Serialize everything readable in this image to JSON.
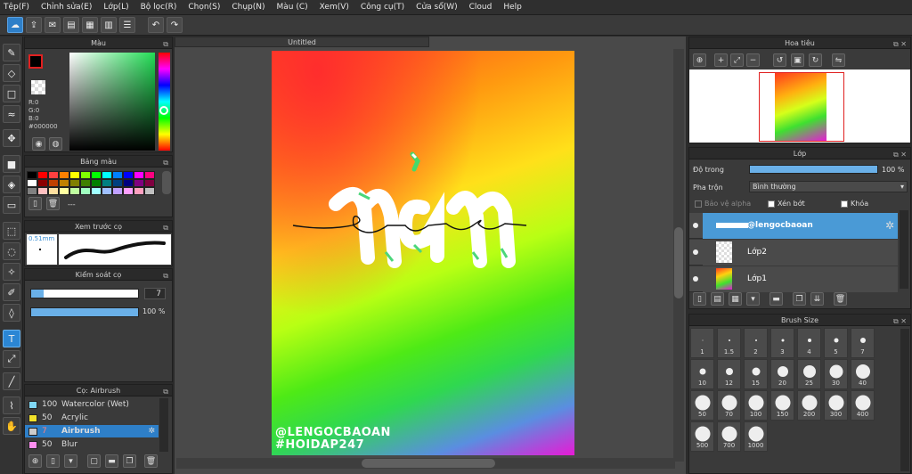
{
  "menu": [
    "Tệp(F)",
    "Chỉnh sửa(E)",
    "Lớp(L)",
    "Bộ lọc(R)",
    "Chọn(S)",
    "Chụp(N)",
    "Màu (C)",
    "Xem(V)",
    "Công cụ(T)",
    "Cửa sổ(W)",
    "Cloud",
    "Help"
  ],
  "color_panel": {
    "title": "Màu",
    "r": "R:0",
    "g": "G:0",
    "b": "B:0",
    "hex": "#000000"
  },
  "palette": {
    "title": "Bảng màu",
    "more": "---",
    "colors": [
      "#000000",
      "#ff0000",
      "#ff4040",
      "#ff8000",
      "#ffff00",
      "#80ff00",
      "#00ff00",
      "#00ffff",
      "#0080ff",
      "#0000ff",
      "#ff00ff",
      "#ff0080",
      "#ffffff",
      "#8b0000",
      "#c04000",
      "#c08000",
      "#808000",
      "#408000",
      "#008000",
      "#008080",
      "#004080",
      "#000080",
      "#800080",
      "#800040",
      "#808080",
      "#ffc0c0",
      "#ffe0a0",
      "#ffffa0",
      "#c0ffa0",
      "#a0ffc0",
      "#a0ffff",
      "#a0c0ff",
      "#c0a0ff",
      "#ffa0ff",
      "#ffa0c0",
      "#c0c0c0"
    ]
  },
  "brush_preview": {
    "title": "Xem trước cọ",
    "size": "0.51mm"
  },
  "brush_control": {
    "title": "Kiểm soát cọ",
    "size": "7",
    "opacity": "100 %"
  },
  "brushes": {
    "title": "Cọ: Airbrush",
    "items": [
      {
        "size": "100",
        "name": "Watercolor (Wet)",
        "color": "#7fd7f5"
      },
      {
        "size": "50",
        "name": "Acrylic",
        "color": "#f2e12a"
      },
      {
        "size": "7",
        "name": "Airbrush",
        "color": "#cccccc",
        "selected": true
      },
      {
        "size": "50",
        "name": "Blur",
        "color": "#ff8ef0"
      }
    ]
  },
  "canvas": {
    "tab": "Untitled",
    "text_tag1": "@LENGOCBAOAN",
    "text_tag2": "#HOIDAP247",
    "lettering": "năm"
  },
  "navigator": {
    "title": "Hoa tiêu"
  },
  "layers": {
    "title": "Lớp",
    "opacity_label": "Độ trong",
    "opacity": "100 %",
    "blend_label": "Pha trộn",
    "blend": "Bình thường",
    "protect_alpha": "Bảo vệ alpha",
    "clipping": "Xén bớt",
    "lock": "Khóa",
    "items": [
      {
        "name": "@lengocbaoan",
        "selected": true
      },
      {
        "name": "Lớp2"
      },
      {
        "name": "Lớp1"
      }
    ]
  },
  "brush_size": {
    "title": "Brush Size",
    "sizes": [
      "1",
      "1.5",
      "2",
      "3",
      "4",
      "5",
      "7",
      "10",
      "12",
      "15",
      "20",
      "25",
      "30",
      "40",
      "50",
      "70",
      "100",
      "150",
      "200",
      "300",
      "400",
      "500",
      "700",
      "1000"
    ]
  },
  "colors": {
    "accent": "#2e7fc8",
    "bar": "#6ab0e8"
  }
}
